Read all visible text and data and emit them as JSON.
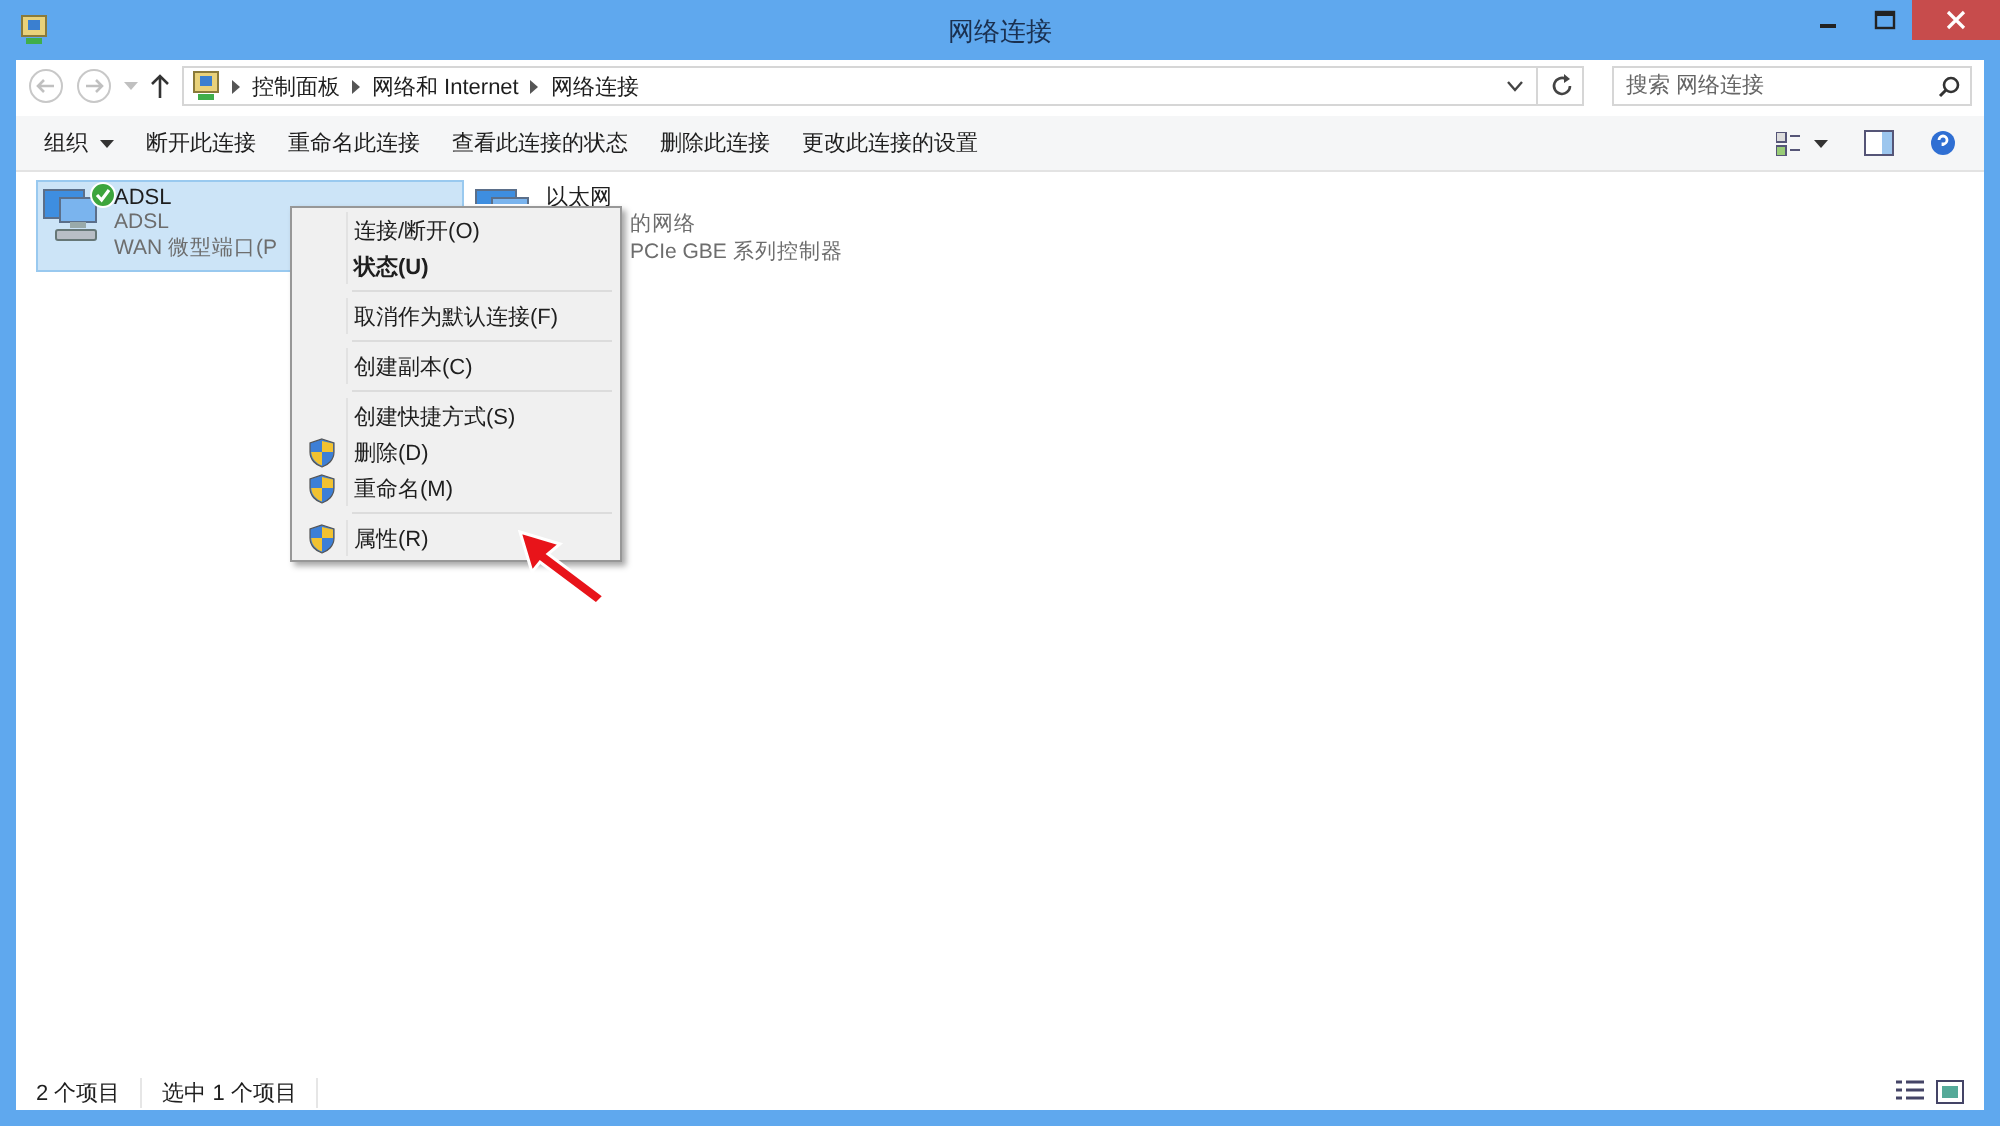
{
  "window": {
    "title": "网络连接"
  },
  "address_bar": {
    "crumbs": [
      "控制面板",
      "网络和 Internet",
      "网络连接"
    ]
  },
  "search": {
    "placeholder": "搜索 网络连接"
  },
  "command_bar": [
    "组织",
    "断开此连接",
    "重命名此连接",
    "查看此连接的状态",
    "删除此连接",
    "更改此连接的设置"
  ],
  "connections": [
    {
      "name": "ADSL",
      "lines": [
        "ADSL",
        "WAN 微型端口(P"
      ],
      "selected": true,
      "connected": true
    },
    {
      "name": "以太网",
      "lines": [
        "的网络",
        "PCIe GBE 系列控制器"
      ],
      "selected": false,
      "connected": false
    }
  ],
  "context_menu": [
    {
      "kind": "item",
      "label": "连接/断开(O)",
      "default": false,
      "shield": false
    },
    {
      "kind": "item",
      "label": "状态(U)",
      "default": true,
      "shield": false
    },
    {
      "kind": "separator"
    },
    {
      "kind": "item",
      "label": "取消作为默认连接(F)",
      "default": false,
      "shield": false
    },
    {
      "kind": "separator"
    },
    {
      "kind": "item",
      "label": "创建副本(C)",
      "default": false,
      "shield": false
    },
    {
      "kind": "separator"
    },
    {
      "kind": "item",
      "label": "创建快捷方式(S)",
      "default": false,
      "shield": false
    },
    {
      "kind": "item",
      "label": "删除(D)",
      "default": false,
      "shield": true
    },
    {
      "kind": "item",
      "label": "重命名(M)",
      "default": false,
      "shield": true
    },
    {
      "kind": "separator"
    },
    {
      "kind": "item",
      "label": "属性(R)",
      "default": false,
      "shield": true
    }
  ],
  "status_bar": [
    "2 个项目",
    "选中 1 个项目"
  ]
}
